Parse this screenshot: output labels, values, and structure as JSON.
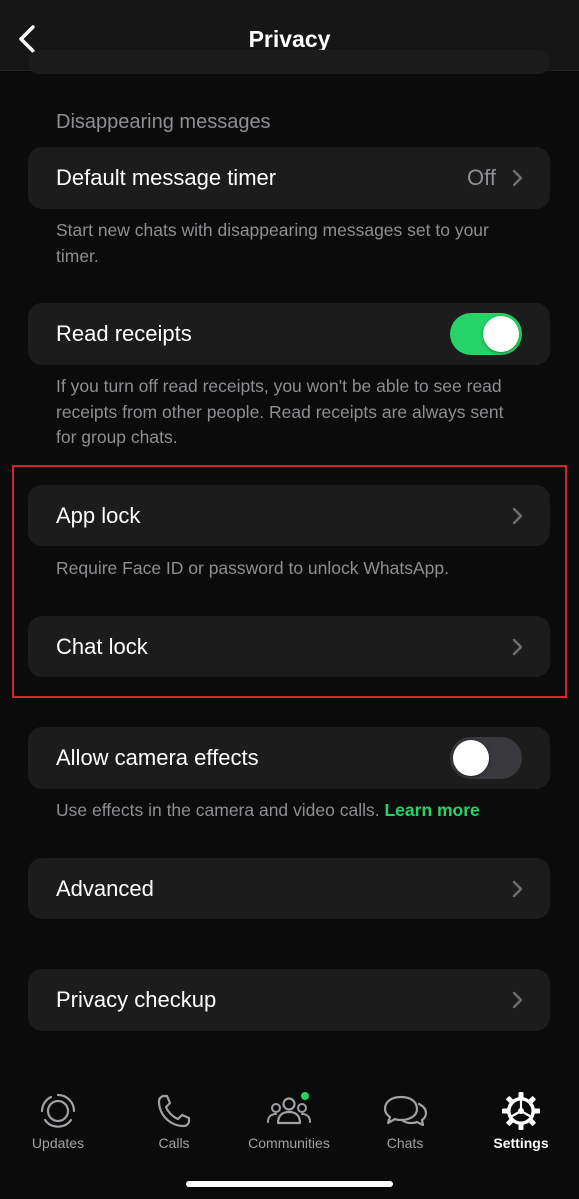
{
  "header": {
    "title": "Privacy",
    "back_icon": "chevron-left-icon"
  },
  "disappearing": {
    "section_label": "Disappearing messages",
    "timer_label": "Default message timer",
    "timer_value": "Off",
    "footnote": "Start new chats with disappearing messages set to your timer."
  },
  "read_receipts": {
    "label": "Read receipts",
    "enabled": true,
    "footnote": "If you turn off read receipts, you won't be able to see read receipts from other people. Read receipts are always sent for group chats."
  },
  "app_lock": {
    "label": "App lock",
    "footnote": "Require Face ID or password to unlock WhatsApp."
  },
  "chat_lock": {
    "label": "Chat lock"
  },
  "camera_effects": {
    "label": "Allow camera effects",
    "enabled": false,
    "footnote": "Use effects in the camera and video calls.",
    "learn_more": "Learn more"
  },
  "advanced": {
    "label": "Advanced"
  },
  "privacy_checkup": {
    "label": "Privacy checkup"
  },
  "tabbar": {
    "tabs": [
      {
        "label": "Updates",
        "icon": "updates-icon",
        "active": false
      },
      {
        "label": "Calls",
        "icon": "phone-icon",
        "active": false
      },
      {
        "label": "Communities",
        "icon": "communities-icon",
        "active": false,
        "badge": true
      },
      {
        "label": "Chats",
        "icon": "chats-icon",
        "active": false
      },
      {
        "label": "Settings",
        "icon": "gear-icon",
        "active": true
      }
    ]
  },
  "colors": {
    "background": "#0b0b0b",
    "card": "#1c1c1d",
    "accent_green": "#25d366",
    "secondary_text": "#8e8e93",
    "highlight_red": "#d7232e"
  }
}
